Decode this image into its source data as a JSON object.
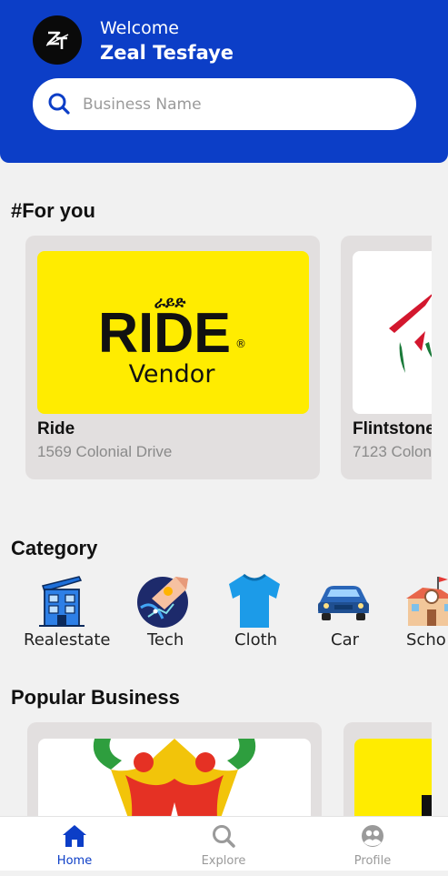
{
  "header": {
    "avatar_initials": "ZT",
    "welcome": "Welcome",
    "username": "Zeal Tesfaye",
    "search_placeholder": "Business Name",
    "bg_color": "#0c3ec7"
  },
  "for_you": {
    "title": "#For you",
    "cards": [
      {
        "name": "Ride",
        "address": "1569 Colonial Drive",
        "logo_text_top": "ራይድ",
        "logo_text_main": "RIDE",
        "logo_text_sub": "Vendor",
        "logo_mark": "®"
      },
      {
        "name": "Flintstone",
        "address": "7123 Colon"
      }
    ]
  },
  "category": {
    "title": "Category",
    "items": [
      {
        "label": "Realestate",
        "icon": "building-icon"
      },
      {
        "label": "Tech",
        "icon": "tech-hand-icon"
      },
      {
        "label": "Cloth",
        "icon": "tshirt-icon"
      },
      {
        "label": "Car",
        "icon": "car-icon"
      },
      {
        "label": "Scho",
        "icon": "school-icon"
      }
    ]
  },
  "popular": {
    "title": "Popular Business"
  },
  "nav": {
    "items": [
      {
        "label": "Home",
        "icon": "home-icon",
        "active": true
      },
      {
        "label": "Explore",
        "icon": "search-icon",
        "active": false
      },
      {
        "label": "Profile",
        "icon": "profile-icon",
        "active": false
      }
    ],
    "active_color": "#0c3ec7",
    "inactive_color": "#9a9a9a"
  }
}
